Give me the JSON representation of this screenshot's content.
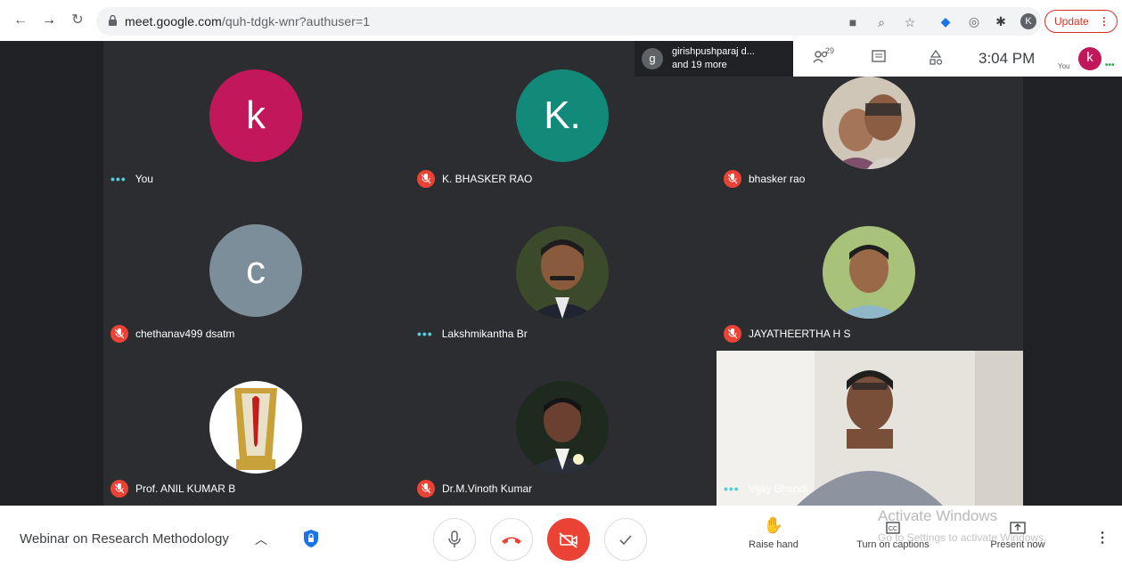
{
  "browser": {
    "url_host": "meet.google.com",
    "url_path": "/quh-tdgk-wnr?authuser=1",
    "profile_initial": "K",
    "update_label": "Update"
  },
  "presenter_chip": {
    "initial": "g",
    "line1": "girishpushparaj d...",
    "line2": "and 19 more"
  },
  "meet_top": {
    "people_count": "29",
    "clock": "3:04 PM",
    "you_label": "You",
    "self_initial": "k"
  },
  "participants": [
    {
      "name": "You",
      "initial": "k",
      "color": "#c2185b",
      "muted": false
    },
    {
      "name": "K. BHASKER RAO",
      "initial": "K.",
      "color": "#128a7a",
      "muted": true
    },
    {
      "name": "bhasker rao",
      "muted": true
    },
    {
      "name": "chethanav499 dsatm",
      "initial": "c",
      "color": "#7c8e99",
      "muted": true
    },
    {
      "name": "Lakshmikantha Br",
      "muted": false
    },
    {
      "name": "JAYATHEERTHA H S",
      "muted": true
    },
    {
      "name": "Prof. ANIL KUMAR B",
      "muted": true
    },
    {
      "name": "Dr.M.Vinoth Kumar",
      "muted": true
    },
    {
      "name": "Vijay Bhandi",
      "muted": false
    }
  ],
  "bottom": {
    "meeting_title": "Webinar on Research Methodology",
    "raise_hand": "Raise hand",
    "captions": "Turn on captions",
    "present": "Present now",
    "watermark_line1": "Activate Windows",
    "watermark_line2": "Go to Settings to activate Windows."
  },
  "colors": {
    "stage_bg": "#202124",
    "tile_bg": "#2c2d30",
    "mute_red": "#ea4335",
    "accent_teal": "#4dd0e1"
  }
}
